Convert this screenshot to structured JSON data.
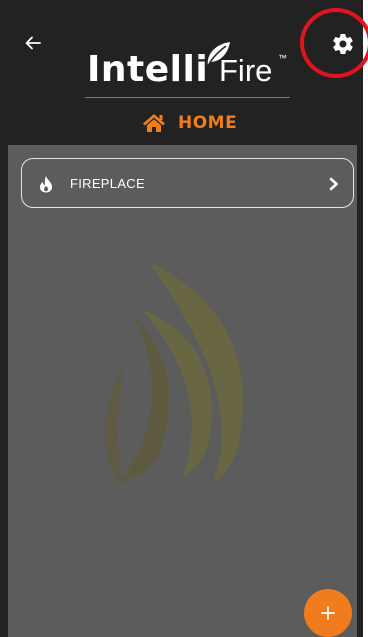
{
  "header": {
    "logo": {
      "brand_bold": "Intelli",
      "brand_light": "Fire",
      "trademark": "™"
    },
    "back_icon": "arrow-left-icon",
    "settings_icon": "gear-icon"
  },
  "nav": {
    "home_label": "HOME",
    "home_icon": "home-icon"
  },
  "devices": [
    {
      "label": "FIREPLACE",
      "icon": "flame-icon"
    }
  ],
  "fab": {
    "label": "+"
  },
  "colors": {
    "accent": "#f07c1d",
    "header_bg": "#222222",
    "content_bg": "#5c5c5c",
    "highlight": "#e0141e"
  }
}
